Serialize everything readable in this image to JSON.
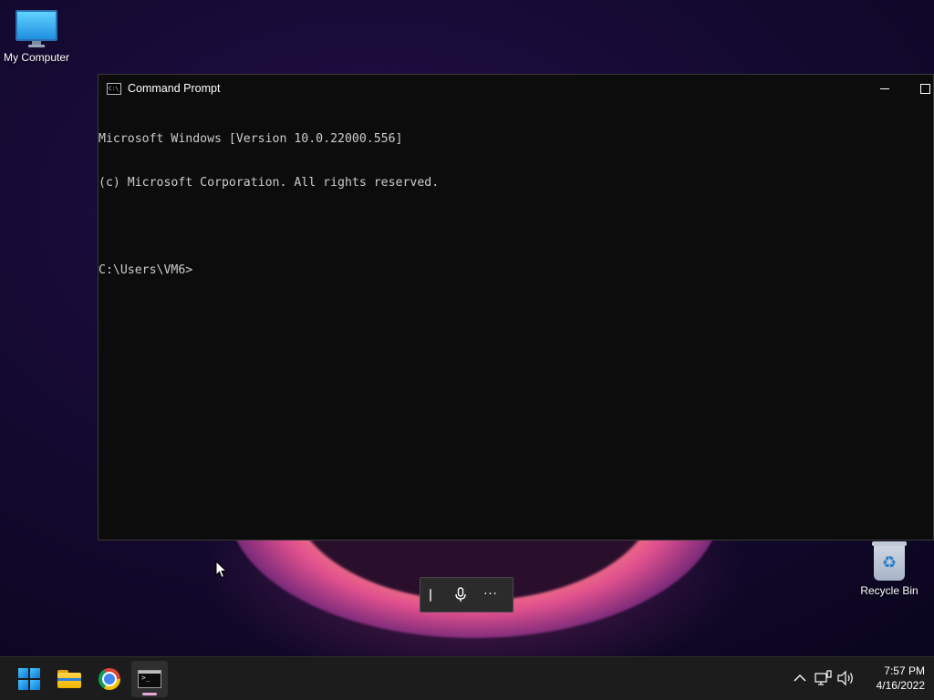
{
  "desktop": {
    "icons": [
      {
        "label": "My Computer"
      },
      {
        "label": "Recycle Bin"
      }
    ]
  },
  "cmd_window": {
    "title": "Command Prompt",
    "lines": [
      "Microsoft Windows [Version 10.0.22000.556]",
      "(c) Microsoft Corporation. All rights reserved.",
      "",
      "C:\\Users\\VM6>"
    ]
  },
  "voice_toolbar": {
    "more_label": "···"
  },
  "taskbar": {
    "apps": [
      {
        "icon": "windows-start-icon"
      },
      {
        "icon": "file-explorer-icon"
      },
      {
        "icon": "chrome-icon"
      },
      {
        "icon": "command-prompt-icon",
        "active": true
      }
    ],
    "tray": {
      "time": "7:57 PM",
      "date": "4/16/2022"
    }
  },
  "colors": {
    "console_bg": "#0c0c0c",
    "console_text": "#cccccc",
    "taskbar_bg": "#1c1c1c",
    "active_indicator": "#e8a9d9"
  }
}
